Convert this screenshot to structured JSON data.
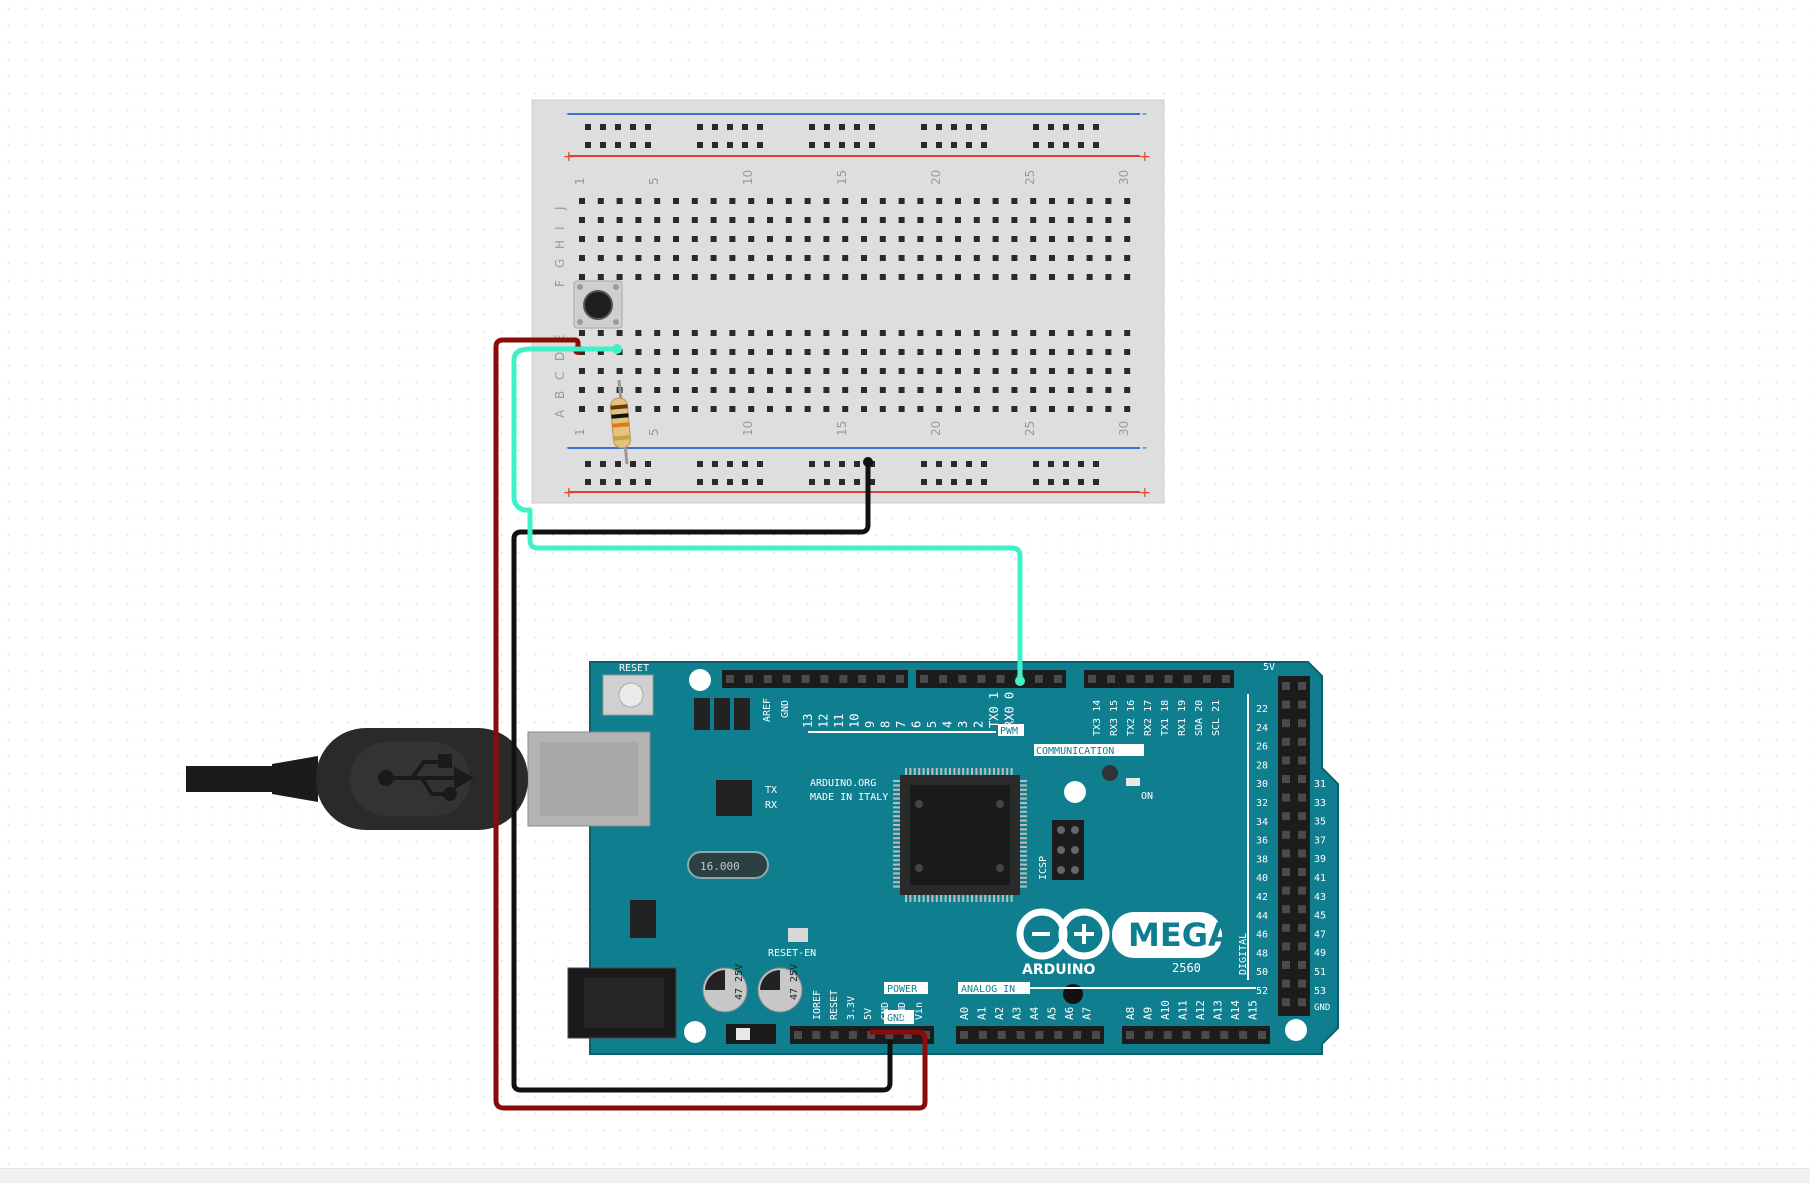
{
  "breadboard": {
    "column_labels": [
      "1",
      "5",
      "10",
      "15",
      "20",
      "25",
      "30"
    ],
    "row_labels_top": [
      "J",
      "I",
      "H",
      "G",
      "F"
    ],
    "row_labels_bottom": [
      "E",
      "D",
      "C",
      "B",
      "A"
    ],
    "rail_minus": "-",
    "rail_plus": "+"
  },
  "arduino": {
    "name": "MEGA",
    "model": "2560",
    "brand": "ARDUINO",
    "reset_label": "RESET",
    "site_label": "ARDUINO.ORG",
    "made_in_label": "MADE IN ITALY",
    "tx_label": "TX",
    "rx_label": "RX",
    "on_label": "ON",
    "aref_label": "AREF",
    "gnd_label": "GND",
    "pwm_label": "PWM",
    "communication_label": "COMMUNICATION",
    "power_label": "POWER",
    "analog_in_label": "ANALOG IN",
    "digital_label": "DIGITAL",
    "icsp_label": "ICSP",
    "reset_en_label": "RESET-EN",
    "five_v_label": "5V",
    "crystal_label": "16.000",
    "pwm_pins": [
      "13",
      "12",
      "11",
      "10",
      "9",
      "8",
      "7",
      "6",
      "5",
      "4",
      "3",
      "2",
      "TX0 1",
      "RX0 0"
    ],
    "comm_pins": [
      "TX3 14",
      "RX3 15",
      "TX2 16",
      "RX2 17",
      "TX1 18",
      "RX1 19",
      "SDA 20",
      "SCL 21"
    ],
    "power_pins": [
      "IOREF",
      "RESET",
      "3.3V",
      "5V",
      "GND",
      "GND",
      "Vin"
    ],
    "analog_pins": [
      "A0",
      "A1",
      "A2",
      "A3",
      "A4",
      "A5",
      "A6",
      "A7",
      "A8",
      "A9",
      "A10",
      "A11",
      "A12",
      "A13",
      "A14",
      "A15"
    ],
    "digital_left": [
      "22",
      "24",
      "26",
      "28",
      "30",
      "32",
      "34",
      "36",
      "38",
      "40",
      "42",
      "44",
      "46",
      "48",
      "50",
      "52"
    ],
    "digital_right": [
      "31",
      "33",
      "35",
      "37",
      "39",
      "41",
      "43",
      "45",
      "47",
      "49",
      "51",
      "53"
    ],
    "cap_label": "47 25V"
  },
  "colors": {
    "board": "#0f7f8f",
    "board_dark": "#0a5f6b",
    "breadboard": "#dcdcdc",
    "wire_red": "#8b0a0a",
    "wire_black": "#111111",
    "wire_cyan": "#40f0c8",
    "rail_blue": "#3a6fd8",
    "rail_red": "#e0402a"
  }
}
